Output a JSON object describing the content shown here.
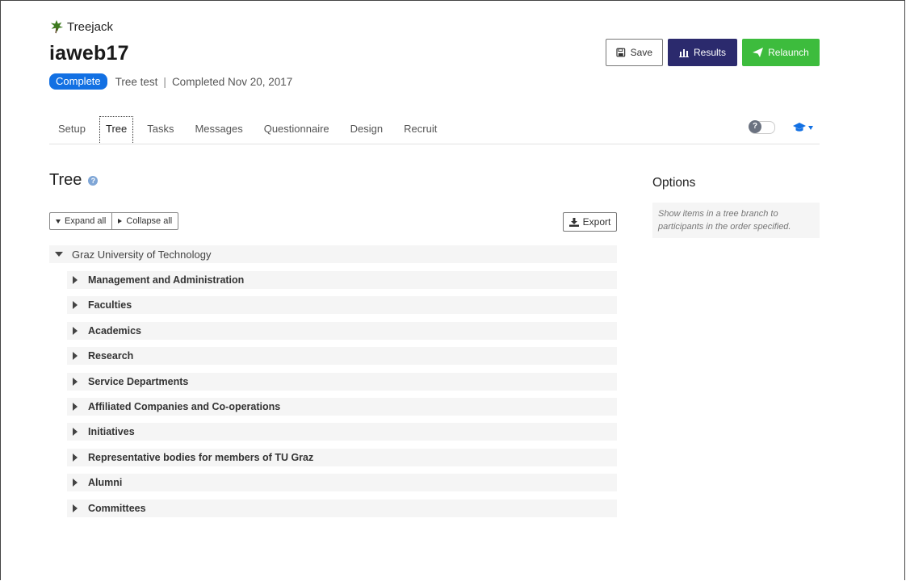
{
  "brand": {
    "name": "Treejack"
  },
  "study": {
    "title": "iaweb17",
    "status_badge": "Complete",
    "type": "Tree test",
    "separator": "|",
    "completed": "Completed Nov 20, 2017"
  },
  "actions": {
    "save": "Save",
    "results": "Results",
    "relaunch": "Relaunch"
  },
  "tabs": [
    {
      "label": "Setup"
    },
    {
      "label": "Tree",
      "active": true
    },
    {
      "label": "Tasks"
    },
    {
      "label": "Messages"
    },
    {
      "label": "Questionnaire"
    },
    {
      "label": "Design"
    },
    {
      "label": "Recruit"
    }
  ],
  "tools": {
    "help_toggle": "?",
    "icons": [
      "help-toggle-icon",
      "graduation-cap-icon",
      "chevron-down-icon"
    ]
  },
  "section": {
    "title": "Tree",
    "help": "?"
  },
  "tree_controls": {
    "expand_all": "Expand all",
    "collapse_all": "Collapse all",
    "export": "Export"
  },
  "tree": {
    "root": "Graz University of Technology",
    "children": [
      "Management and Administration",
      "Faculties",
      "Academics",
      "Research",
      "Service Departments",
      "Affiliated Companies and Co-operations",
      "Initiatives",
      "Representative bodies for members of TU Graz",
      "Alumni",
      "Committees"
    ]
  },
  "options": {
    "title": "Options",
    "description": "Show items in a tree branch to participants in the order specified."
  },
  "colors": {
    "badge": "#1270e3",
    "results_button": "#2b2a6d",
    "relaunch_button": "#3dbc3d",
    "row_background": "#f5f5f5",
    "brand_logo": "#3c7a1e"
  }
}
